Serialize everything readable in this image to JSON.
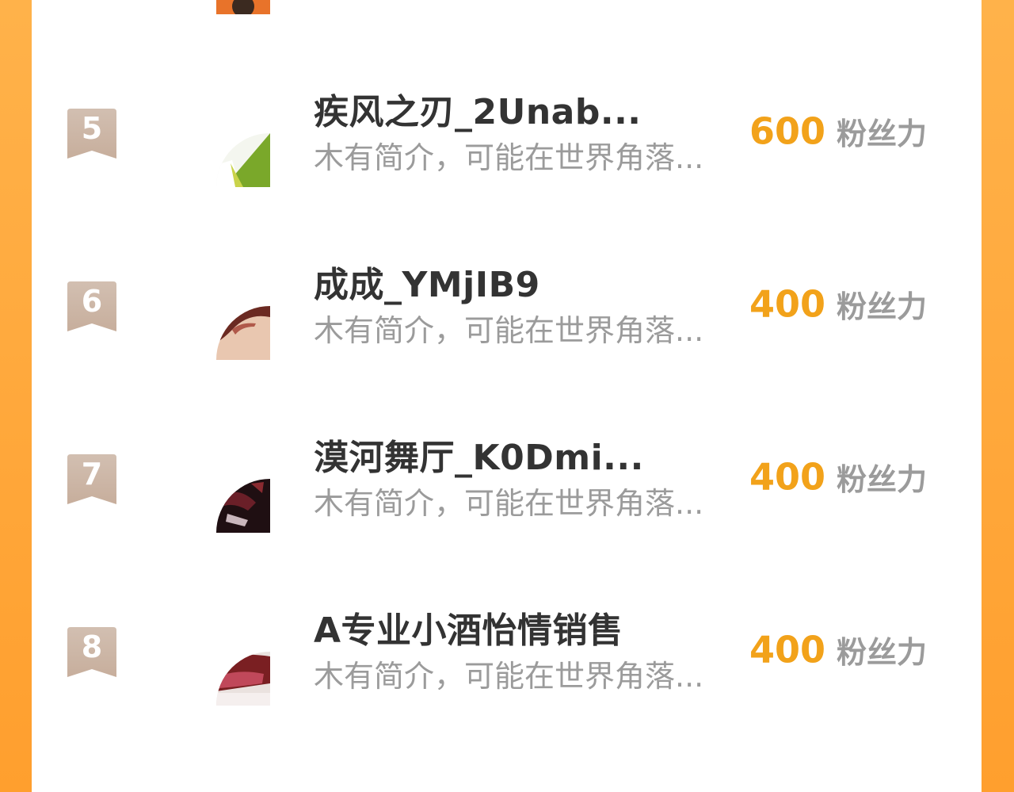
{
  "colors": {
    "background": "#ff9f2e",
    "panel": "#ffffff",
    "name_text": "#333333",
    "bio_text": "#9b9b9b",
    "score_accent": "#f2a21a",
    "rank_badge": "#cdb4a3"
  },
  "rows": [
    {
      "rank": "5",
      "name": "疾风之刃_2Unab...",
      "bio": "木有简介，可能在世界角落...",
      "score": "600",
      "unit": "粉丝力",
      "avatar_icon": "green-leaf-avatar"
    },
    {
      "rank": "6",
      "name": "成成_YMjIB9",
      "bio": "木有简介，可能在世界角落...",
      "score": "400",
      "unit": "粉丝力",
      "avatar_icon": "skin-tone-avatar"
    },
    {
      "rank": "7",
      "name": "漠河舞厅_K0Dmi...",
      "bio": "木有简介，可能在世界角落...",
      "score": "400",
      "unit": "粉丝力",
      "avatar_icon": "dark-portrait-avatar"
    },
    {
      "rank": "8",
      "name": "A专业小酒怡情销售",
      "bio": "木有简介，可能在世界角落...",
      "score": "400",
      "unit": "粉丝力",
      "avatar_icon": "red-object-avatar"
    }
  ]
}
